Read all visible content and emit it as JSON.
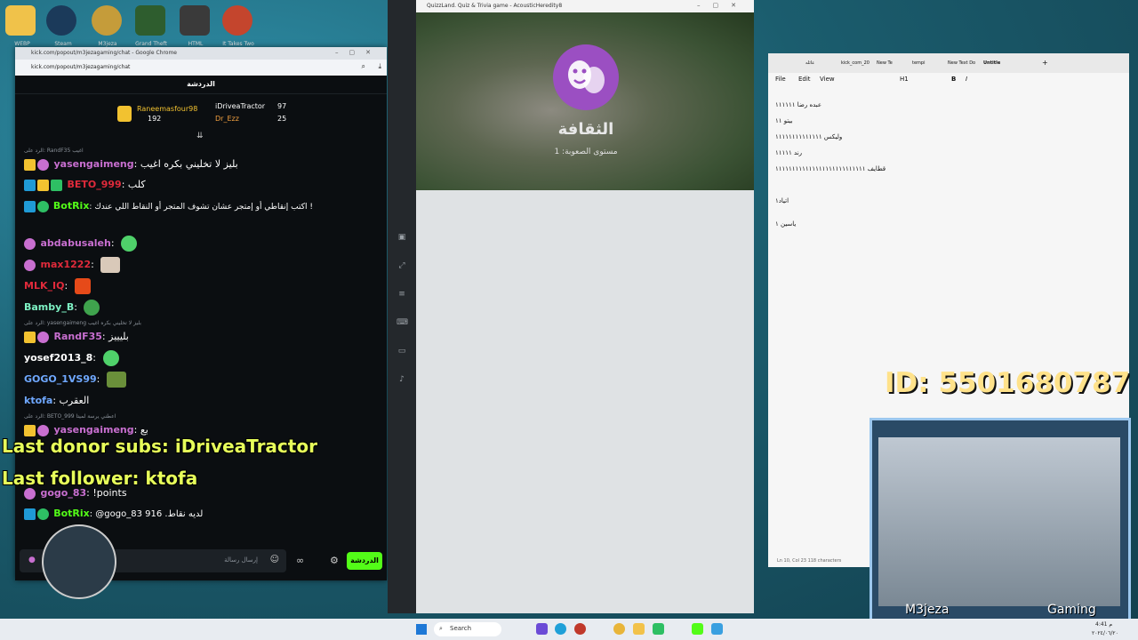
{
  "desktop": {
    "icons": [
      {
        "label": "WEBP",
        "color": "#f0c24a"
      },
      {
        "label": "Steam",
        "color": "#1b3a5a"
      },
      {
        "label": "M3jeza",
        "color": "#c59c3a"
      },
      {
        "label": "Grand Theft Auto V",
        "color": "#2e5d2e"
      },
      {
        "label": "HTML",
        "color": "#3a3a3a"
      },
      {
        "label": "It Takes Two",
        "color": "#c4452d"
      }
    ]
  },
  "chat_window": {
    "title": "kick.com/popout/m3jezagaming/chat - Google Chrome",
    "url": "kick.com/popout/m3jezagaming/chat",
    "header": "الدردشة",
    "leaders": [
      {
        "name": "Raneemasfour98",
        "value": "192"
      },
      {
        "name": "iDriveaTractor",
        "value": "97"
      },
      {
        "name": "Dr_Ezz",
        "value": "25"
      }
    ],
    "messages": [
      {
        "reply": "الرد على: RandF35 اغيب",
        "user": "yasengaimeng",
        "color": "#c86fd0",
        "text": "بليز لا تخليني بكره اغيب"
      },
      {
        "user": "BETO_999",
        "color": "#e02a3b",
        "text": "كلب"
      },
      {
        "user": "BotRix",
        "color": "#53fc18",
        "text": "اكتب إنقاطي أو إمتجر عشان تشوف المتجر أو النقاط اللي عندك !"
      },
      {
        "user": "abdabusaleh",
        "color": "#c86fd0",
        "text": ""
      },
      {
        "user": "max1222",
        "color": "#e02a3b",
        "text": ""
      },
      {
        "user": "MLK_IQ",
        "color": "#e02a3b",
        "text": ""
      },
      {
        "user": "Bamby_B",
        "color": "#7ef2c4",
        "text": ""
      },
      {
        "reply": "الرد على: yasengaimeng بليز لا تخليني بكره اغيب",
        "user": "RandF35",
        "color": "#c86fd0",
        "text": "بليييز"
      },
      {
        "user": "yosef2013_8",
        "color": "#ffffff",
        "text": ""
      },
      {
        "user": "GOGO_1VS99",
        "color": "#6fa8ff",
        "text": ""
      },
      {
        "user": "ktofa",
        "color": "#6fa8ff",
        "text": "العقرب"
      },
      {
        "reply": "الرد على: BETO_999 اعطني يرسة لميتا",
        "user": "yasengaimeng",
        "color": "#c86fd0",
        "text": "بع"
      },
      {
        "user": "gogo_83",
        "color": "#c86fd0",
        "text": "!points"
      },
      {
        "user": "BotRix",
        "color": "#53fc18",
        "text": "@gogo_83 916 .لديه نقاط"
      }
    ],
    "overlay_donor": "Last donor subs: iDriveaTractor",
    "overlay_follower": "Last follower: ktofa",
    "input_placeholder": "إرسال رسالة",
    "send_label": "الدردشة"
  },
  "game_window": {
    "title": "QuizzLand. Quiz & Trivia game - AcousticHeredity8",
    "category": "الثقافة",
    "level": "مستوى الصعوبة: 1",
    "accent": "#9b4fc2"
  },
  "notepad": {
    "tabs": [
      "عائله",
      "kick_com_20",
      "New Te",
      "tempi",
      "New Text Do",
      "Untitle"
    ],
    "menu": [
      "File",
      "Edit",
      "View"
    ],
    "heading_style": "H1",
    "lines": [
      "عبده رضا ١١١١١١",
      "بيتو ١١",
      "وليكس ١١١١١١١١١١١١١١",
      "رند ١١١١١",
      "قطايف ١١١١١١١١١١١١١١١١١١١١١١١١١١١",
      "اتياد١",
      "ياسين ١"
    ],
    "status": "Ln 10, Col 23    118 characters"
  },
  "overlay": {
    "id_text": "ID: 5501680787",
    "cam_name": "M3jeza",
    "cam_tag": "Gaming"
  },
  "taskbar": {
    "search_label": "Search",
    "time": "4:41 م",
    "date": "٢٠٢٤/٠٦/٢٠"
  }
}
